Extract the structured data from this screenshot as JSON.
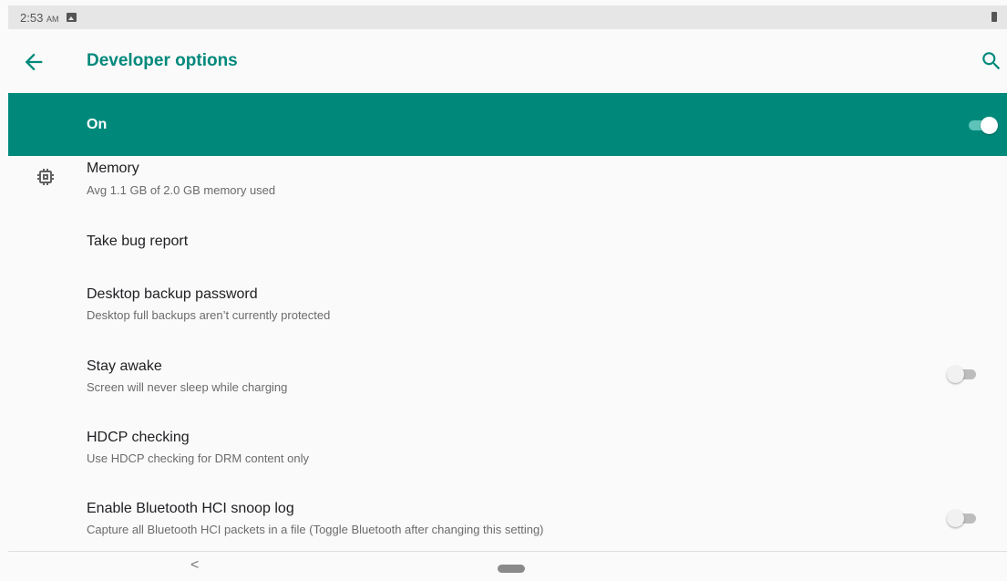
{
  "status_bar": {
    "time": "2:53",
    "ampm": "AM"
  },
  "toolbar": {
    "title": "Developer options"
  },
  "master_switch": {
    "label": "On",
    "state": "on"
  },
  "items": [
    {
      "title": "Memory",
      "subtitle": "Avg 1.1 GB of 2.0 GB memory used",
      "icon": "memory-chip-icon"
    },
    {
      "title": "Take bug report"
    },
    {
      "title": "Desktop backup password",
      "subtitle": "Desktop full backups aren’t currently protected"
    },
    {
      "title": "Stay awake",
      "subtitle": "Screen will never sleep while charging",
      "switch_state": "off"
    },
    {
      "title": "HDCP checking",
      "subtitle": "Use HDCP checking for DRM content only"
    },
    {
      "title": "Enable Bluetooth HCI snoop log",
      "subtitle": "Capture all Bluetooth HCI packets in a file (Toggle Bluetooth after changing this setting)",
      "switch_state": "off"
    }
  ],
  "nav_bar": {
    "back_glyph": "<"
  },
  "colors": {
    "accent": "#00897b",
    "background": "#fafafa"
  }
}
